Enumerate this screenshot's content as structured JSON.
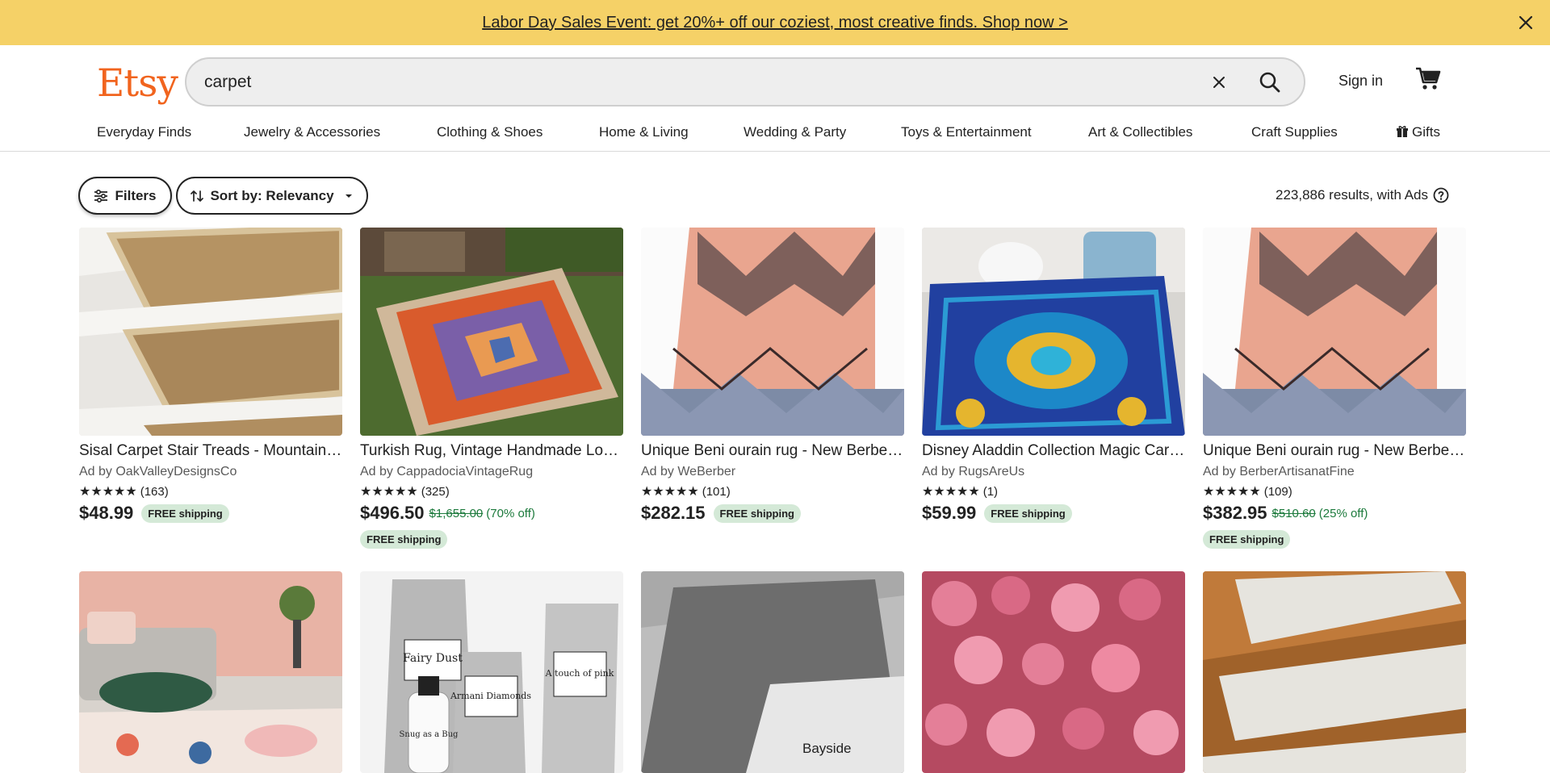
{
  "promo": {
    "text": "Labor Day Sales Event: get 20%+ off our coziest, most creative finds. Shop now >",
    "close_icon": "close-icon"
  },
  "header": {
    "logo": "Etsy",
    "search_value": "carpet",
    "signin_label": "Sign in",
    "cart_icon": "cart-icon",
    "brand_color": "#f1641e"
  },
  "categories": [
    {
      "label": "Everyday Finds"
    },
    {
      "label": "Jewelry & Accessories"
    },
    {
      "label": "Clothing & Shoes"
    },
    {
      "label": "Home & Living"
    },
    {
      "label": "Wedding & Party"
    },
    {
      "label": "Toys & Entertainment"
    },
    {
      "label": "Art & Collectibles"
    },
    {
      "label": "Craft Supplies"
    },
    {
      "label": "Gifts"
    }
  ],
  "toolbar": {
    "filters_label": "Filters",
    "sort_label": "Sort by: Relevancy",
    "results_text": "223,886 results, with Ads"
  },
  "listings": [
    {
      "title": "Sisal Carpet Stair Treads - Mountain Weave Sisal",
      "shop": "Ad by OakValleyDesignsCo",
      "stars": "★★★★★",
      "reviews": "(163)",
      "price": "$48.99",
      "original_price": "",
      "discount": "",
      "shipping": "FREE shipping"
    },
    {
      "title": "Turkish Rug, Vintage Handmade Low Pile Oushak Rug",
      "shop": "Ad by CappadociaVintageRug",
      "stars": "★★★★★",
      "reviews": "(325)",
      "price": "$496.50",
      "original_price": "$1,655.00",
      "discount": "(70% off)",
      "shipping": "FREE shipping"
    },
    {
      "title": "Unique Beni ourain rug - New Berber rug",
      "shop": "Ad by WeBerber",
      "stars": "★★★★★",
      "reviews": "(101)",
      "price": "$282.15",
      "original_price": "",
      "discount": "",
      "shipping": "FREE shipping"
    },
    {
      "title": "Disney Aladdin Collection Magic Carpet Rug",
      "shop": "Ad by RugsAreUs",
      "stars": "★★★★★",
      "reviews": "(1)",
      "price": "$59.99",
      "original_price": "",
      "discount": "",
      "shipping": "FREE shipping"
    },
    {
      "title": "Unique Beni ourain rug - New Berber rug",
      "shop": "Ad by BerberArtisanatFine",
      "stars": "★★★★★",
      "reviews": "(109)",
      "price": "$382.95",
      "original_price": "$510.60",
      "discount": "(25% off)",
      "shipping": "FREE shipping"
    }
  ],
  "lower_listings": [
    {
      "image": "living-room-rug-image"
    },
    {
      "image": "fragrance-pouches-image",
      "labels": [
        "Fairy Dust",
        "Armani Diamonds",
        "A touch of pink",
        "Snug as a Bug"
      ]
    },
    {
      "image": "stair-tread-image",
      "caption": "Bayside"
    },
    {
      "image": "pink-succulent-image"
    },
    {
      "image": "stair-tread-wood-image"
    }
  ]
}
